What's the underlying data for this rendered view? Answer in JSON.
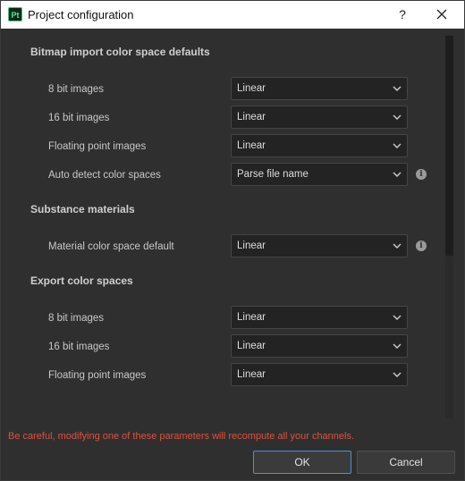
{
  "window": {
    "title": "Project configuration",
    "app_logo_text": "Pt",
    "help_label": "?",
    "close_icon": "close-icon"
  },
  "sections": {
    "bitmap": {
      "title": "Bitmap import color space defaults",
      "rows": [
        {
          "label": "8 bit images",
          "value": "Linear"
        },
        {
          "label": "16 bit images",
          "value": "Linear"
        },
        {
          "label": "Floating point images",
          "value": "Linear"
        },
        {
          "label": "Auto detect color spaces",
          "value": "Parse file name"
        }
      ]
    },
    "substance": {
      "title": "Substance materials",
      "rows": [
        {
          "label": "Material color space default",
          "value": "Linear"
        }
      ]
    },
    "export": {
      "title": "Export color spaces",
      "rows": [
        {
          "label": "8 bit images",
          "value": "Linear"
        },
        {
          "label": "16 bit images",
          "value": "Linear"
        },
        {
          "label": "Floating point images",
          "value": "Linear"
        }
      ]
    }
  },
  "info_glyph": "i",
  "warning": "Be careful, modifying one of these parameters will recompute all your channels.",
  "buttons": {
    "ok": "OK",
    "cancel": "Cancel"
  },
  "colors": {
    "warning": "#e0503a",
    "ok_border": "#4f8fd8",
    "background": "#2f2f2f"
  }
}
